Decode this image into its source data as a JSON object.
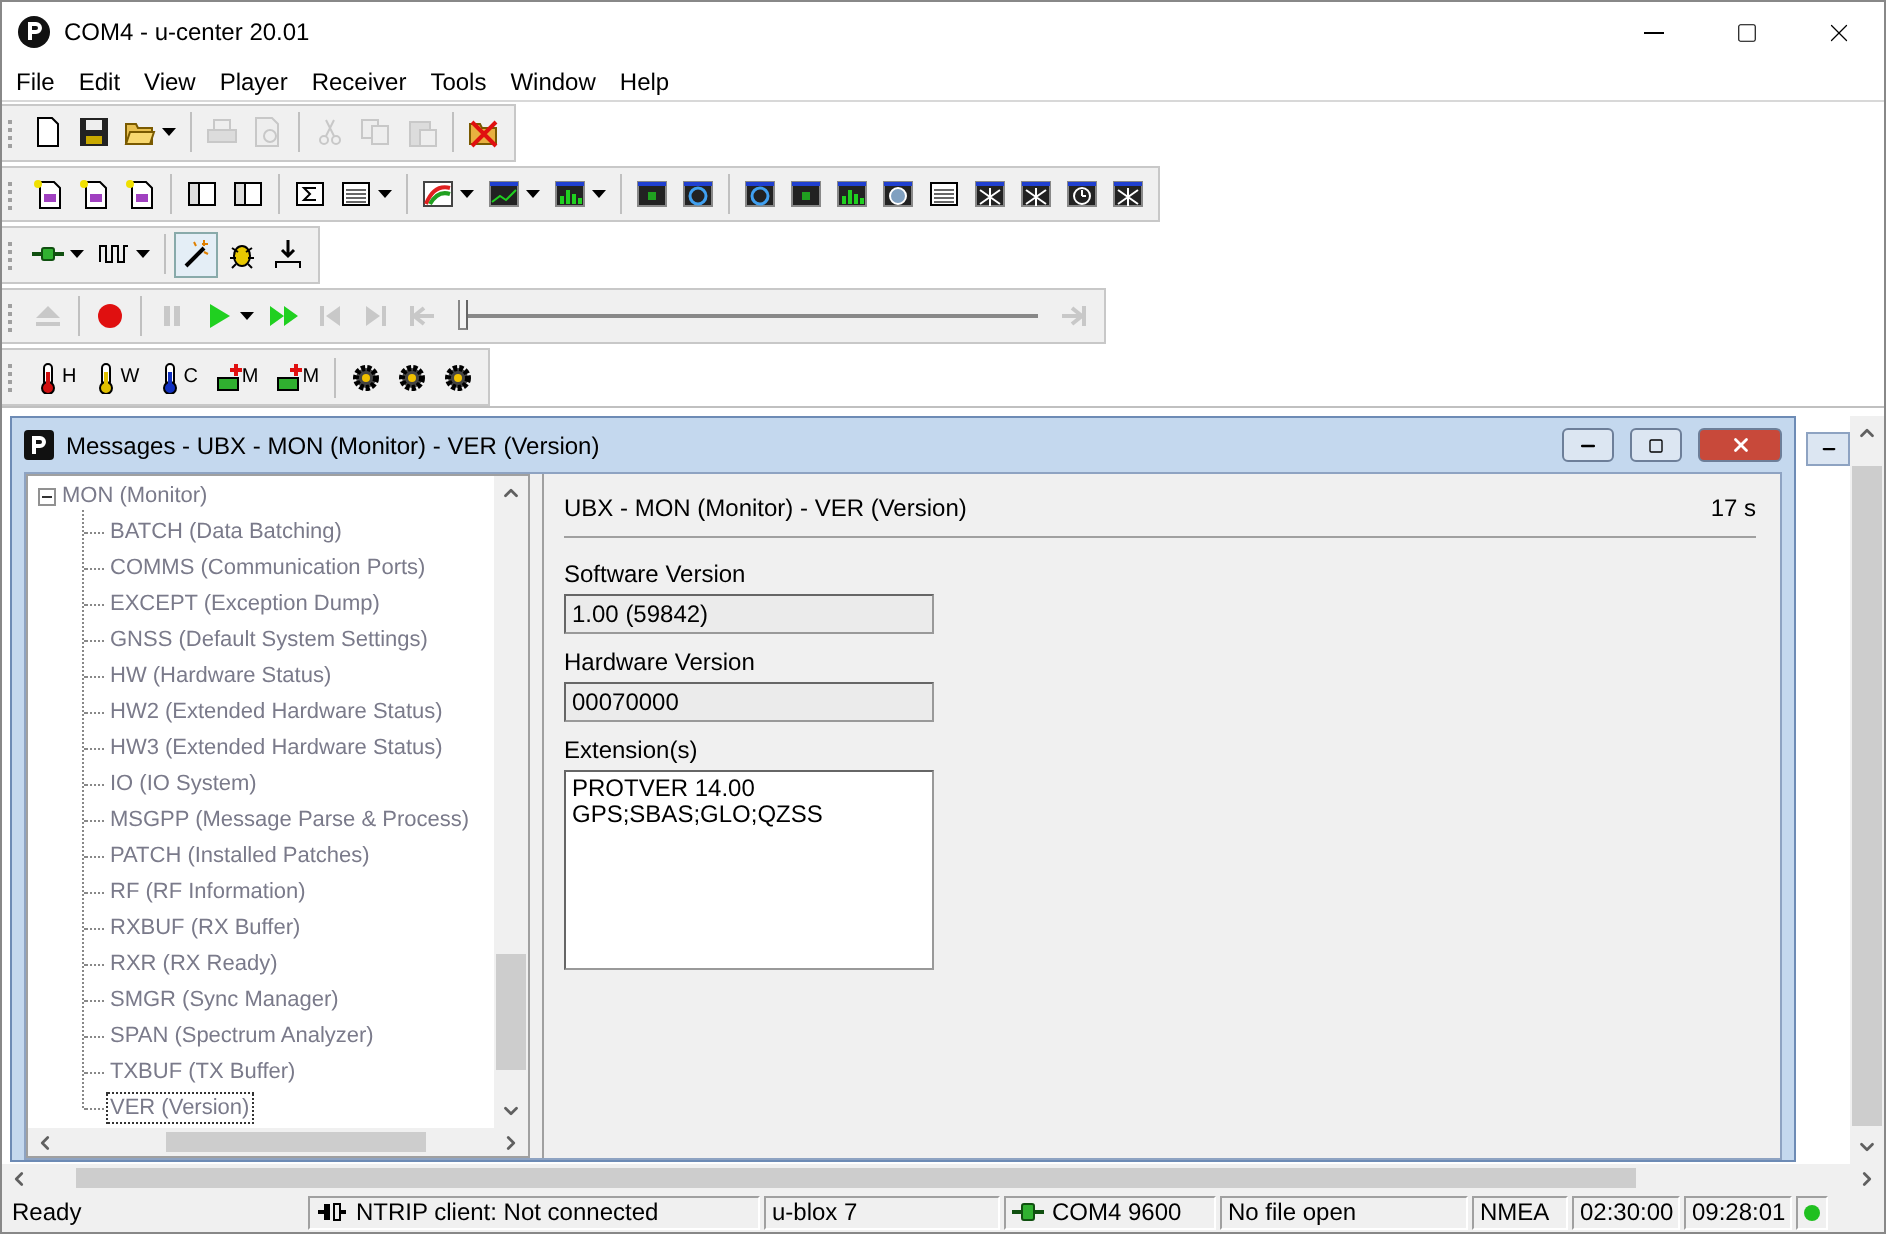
{
  "window": {
    "title": "COM4 - u-center 20.01"
  },
  "menu": [
    "File",
    "Edit",
    "View",
    "Player",
    "Receiver",
    "Tools",
    "Window",
    "Help"
  ],
  "toolbars": [
    {
      "items": [
        {
          "kind": "new",
          "disabled": false
        },
        {
          "kind": "save",
          "disabled": false
        },
        {
          "kind": "open",
          "disabled": false,
          "dropdown": true
        },
        {
          "kind": "separator"
        },
        {
          "kind": "print",
          "disabled": true
        },
        {
          "kind": "preview",
          "disabled": true
        },
        {
          "kind": "separator"
        },
        {
          "kind": "cut",
          "disabled": true
        },
        {
          "kind": "copy",
          "disabled": true
        },
        {
          "kind": "paste",
          "disabled": true
        },
        {
          "kind": "separator"
        },
        {
          "kind": "crossed",
          "disabled": false
        }
      ]
    },
    {
      "items": [
        {
          "kind": "docstar",
          "disabled": false
        },
        {
          "kind": "docstar",
          "disabled": false
        },
        {
          "kind": "docstar",
          "disabled": false
        },
        {
          "kind": "separator"
        },
        {
          "kind": "layout",
          "disabled": false
        },
        {
          "kind": "layout",
          "disabled": false
        },
        {
          "kind": "separator"
        },
        {
          "kind": "sigma",
          "disabled": false
        },
        {
          "kind": "table",
          "disabled": false,
          "dropdown": true
        },
        {
          "kind": "separator"
        },
        {
          "kind": "skyview",
          "disabled": false,
          "dropdown": true
        },
        {
          "kind": "linechart",
          "disabled": false,
          "dropdown": true
        },
        {
          "kind": "barchart",
          "disabled": false,
          "dropdown": true
        },
        {
          "kind": "separator"
        },
        {
          "kind": "screen",
          "disabled": false
        },
        {
          "kind": "target",
          "disabled": false
        },
        {
          "kind": "separator"
        },
        {
          "kind": "target",
          "disabled": false
        },
        {
          "kind": "screen",
          "disabled": false
        },
        {
          "kind": "barchart",
          "disabled": false
        },
        {
          "kind": "globe",
          "disabled": false
        },
        {
          "kind": "table",
          "disabled": false
        },
        {
          "kind": "burst",
          "disabled": false
        },
        {
          "kind": "burst",
          "disabled": false
        },
        {
          "kind": "clock",
          "disabled": false
        },
        {
          "kind": "burst",
          "disabled": false
        }
      ]
    },
    {
      "items": [
        {
          "kind": "plug",
          "disabled": false,
          "dropdown": true
        },
        {
          "kind": "wave",
          "disabled": false,
          "dropdown": true
        },
        {
          "kind": "separator"
        },
        {
          "kind": "wand",
          "disabled": false,
          "pressed": true
        },
        {
          "kind": "bug",
          "disabled": false
        },
        {
          "kind": "download",
          "disabled": false
        }
      ]
    },
    {
      "items": [
        {
          "kind": "eject",
          "disabled": true
        },
        {
          "kind": "separator"
        },
        {
          "kind": "record",
          "disabled": false
        },
        {
          "kind": "separator"
        },
        {
          "kind": "pause",
          "disabled": true
        },
        {
          "kind": "play",
          "disabled": false,
          "dropdown": true
        },
        {
          "kind": "fastforward",
          "disabled": false
        },
        {
          "kind": "stepback",
          "disabled": true
        },
        {
          "kind": "stepforward",
          "disabled": true
        },
        {
          "kind": "tostart",
          "disabled": true
        },
        {
          "kind": "slider",
          "level": 0
        },
        {
          "kind": "toend",
          "disabled": true
        }
      ]
    },
    {
      "items": [
        {
          "kind": "thermometer",
          "disabled": false,
          "label": "H",
          "color": "#d01010"
        },
        {
          "kind": "thermometer",
          "disabled": false,
          "label": "W",
          "color": "#e0c000"
        },
        {
          "kind": "thermometer",
          "disabled": false,
          "label": "C",
          "color": "#1030c0"
        },
        {
          "kind": "memory",
          "disabled": false,
          "label": "M"
        },
        {
          "kind": "memory",
          "disabled": false,
          "label": "M"
        },
        {
          "kind": "separator"
        },
        {
          "kind": "gear",
          "disabled": false
        },
        {
          "kind": "gear",
          "disabled": false
        },
        {
          "kind": "gear",
          "disabled": false
        }
      ]
    }
  ],
  "messages_window": {
    "title": "Messages - UBX - MON (Monitor) - VER (Version)",
    "tree": {
      "label": "MON (Monitor)",
      "expanded": true,
      "disabled": true,
      "children": [
        {
          "label": "BATCH (Data Batching)",
          "selected": false,
          "disabled": true
        },
        {
          "label": "COMMS (Communication Ports)",
          "selected": false,
          "disabled": true
        },
        {
          "label": "EXCEPT (Exception Dump)",
          "selected": false,
          "disabled": true
        },
        {
          "label": "GNSS (Default System Settings)",
          "selected": false,
          "disabled": true
        },
        {
          "label": "HW (Hardware Status)",
          "selected": false,
          "disabled": true
        },
        {
          "label": "HW2 (Extended Hardware Status)",
          "selected": false,
          "disabled": true
        },
        {
          "label": "HW3 (Extended Hardware Status)",
          "selected": false,
          "disabled": true
        },
        {
          "label": "IO (IO System)",
          "selected": false,
          "disabled": true
        },
        {
          "label": "MSGPP (Message Parse & Process)",
          "selected": false,
          "disabled": true
        },
        {
          "label": "PATCH (Installed Patches)",
          "selected": false,
          "disabled": true
        },
        {
          "label": "RF (RF Information)",
          "selected": false,
          "disabled": true
        },
        {
          "label": "RXBUF (RX Buffer)",
          "selected": false,
          "disabled": true
        },
        {
          "label": "RXR (RX Ready)",
          "selected": false,
          "disabled": true
        },
        {
          "label": "SMGR (Sync Manager)",
          "selected": false,
          "disabled": true
        },
        {
          "label": "SPAN (Spectrum Analyzer)",
          "selected": false,
          "disabled": true
        },
        {
          "label": "TXBUF (TX Buffer)",
          "selected": false,
          "disabled": true
        },
        {
          "label": "VER (Version)",
          "selected": true,
          "disabled": true
        }
      ]
    },
    "detail": {
      "heading": "UBX - MON (Monitor) - VER (Version)",
      "age": "17 s",
      "fields": [
        {
          "label": "Software Version",
          "value": "1.00 (59842)"
        },
        {
          "label": "Hardware Version",
          "value": "00070000"
        }
      ],
      "extensions": {
        "label": "Extension(s)",
        "lines": [
          "PROTVER 14.00",
          "GPS;SBAS;GLO;QZSS"
        ]
      }
    }
  },
  "status_bar": [
    {
      "kind": "text",
      "text": "Ready"
    },
    {
      "kind": "ntrip",
      "text": "NTRIP client: Not connected"
    },
    {
      "kind": "text",
      "text": "u-blox 7"
    },
    {
      "kind": "port",
      "text": "COM4 9600"
    },
    {
      "kind": "text",
      "text": "No file open"
    },
    {
      "kind": "text",
      "text": "NMEA"
    },
    {
      "kind": "text",
      "text": "02:30:00"
    },
    {
      "kind": "text",
      "text": "09:28:01"
    },
    {
      "kind": "led",
      "color": "#20c020"
    }
  ]
}
